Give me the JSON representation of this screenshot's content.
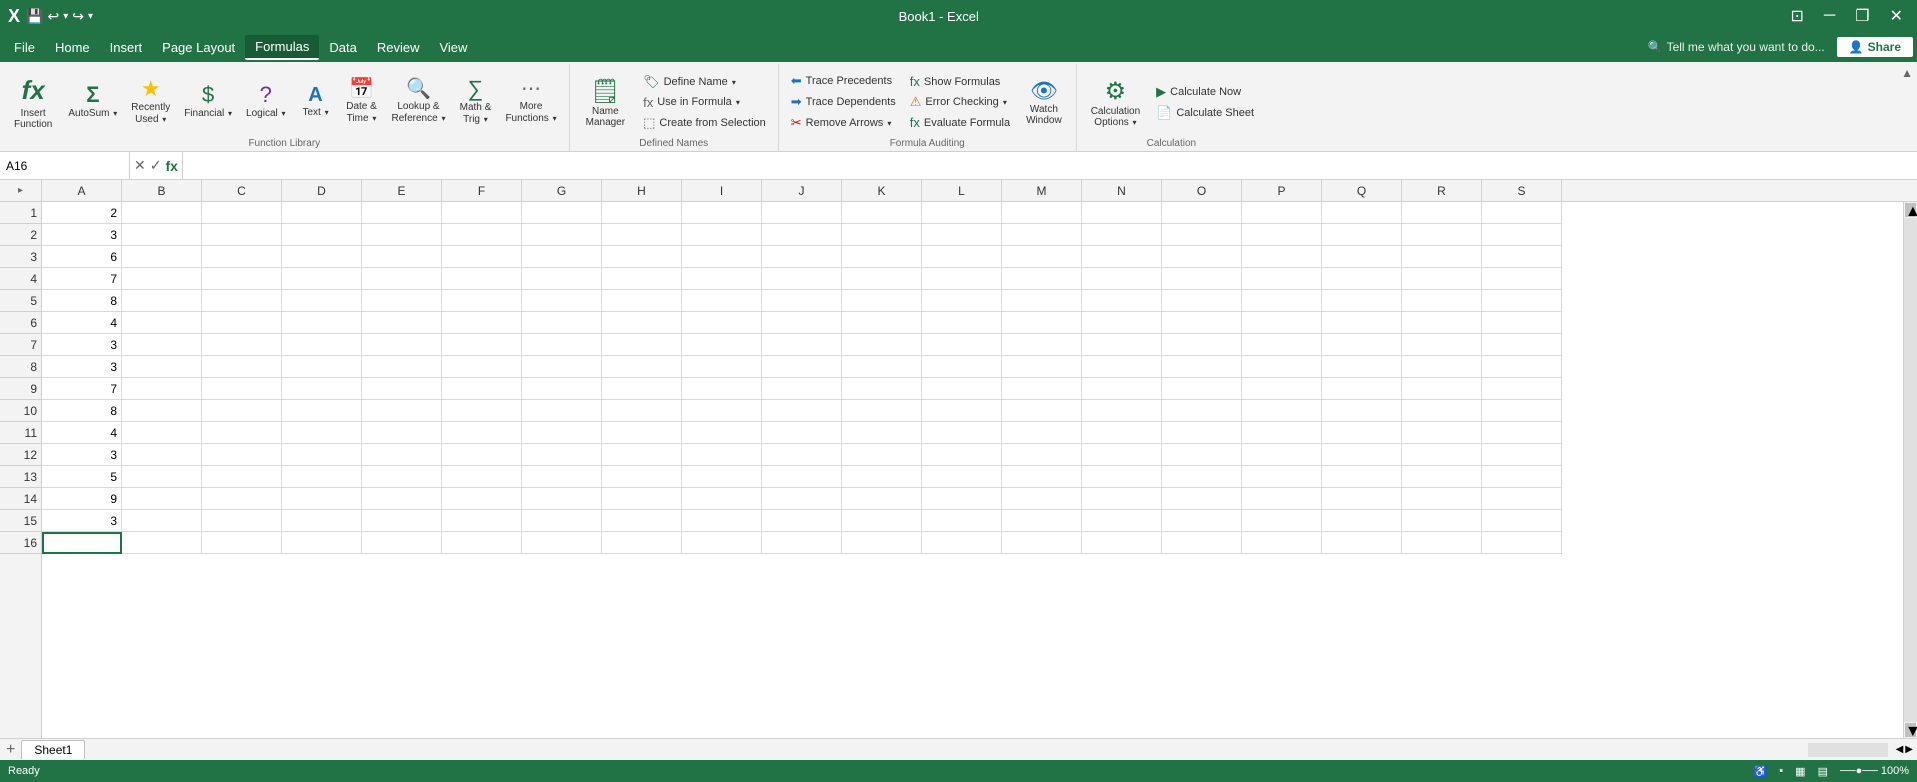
{
  "titlebar": {
    "title": "Book1 - Excel",
    "save_icon": "💾",
    "undo_icon": "↩",
    "redo_icon": "↪",
    "dropdown_icon": "▾",
    "minimize_icon": "─",
    "restore_icon": "❐",
    "close_icon": "✕",
    "window_icon": "⊞"
  },
  "menubar": {
    "items": [
      "File",
      "Home",
      "Insert",
      "Page Layout",
      "Formulas",
      "Data",
      "Review",
      "View"
    ],
    "active": "Formulas",
    "search_placeholder": "Tell me what you want to do...",
    "share_label": "Share"
  },
  "ribbon": {
    "groups": [
      {
        "id": "function-library",
        "label": "Function Library",
        "items": [
          {
            "id": "insert-function",
            "icon": "fx",
            "label": "Insert\nFunction"
          },
          {
            "id": "autosum",
            "icon": "Σ",
            "label": "AutoSum",
            "dropdown": true
          },
          {
            "id": "recently-used",
            "icon": "★",
            "label": "Recently\nUsed",
            "dropdown": true
          },
          {
            "id": "financial",
            "icon": "₤",
            "label": "Financial",
            "dropdown": true
          },
          {
            "id": "logical",
            "icon": "?",
            "label": "Logical",
            "dropdown": true
          },
          {
            "id": "text",
            "icon": "A",
            "label": "Text",
            "dropdown": true
          },
          {
            "id": "date-time",
            "icon": "📅",
            "label": "Date &\nTime",
            "dropdown": true
          },
          {
            "id": "lookup-reference",
            "icon": "🔍",
            "label": "Lookup &\nReference",
            "dropdown": true
          },
          {
            "id": "math-trig",
            "icon": "∑",
            "label": "Math &\nTrig",
            "dropdown": true
          },
          {
            "id": "more-functions",
            "icon": "⋯",
            "label": "More\nFunctions",
            "dropdown": true
          }
        ]
      },
      {
        "id": "defined-names",
        "label": "Defined Names",
        "items": [
          {
            "id": "name-manager",
            "icon": "🗒",
            "label": "Name\nManager"
          },
          {
            "id": "define-name",
            "label": "Define Name",
            "dropdown": true
          },
          {
            "id": "use-in-formula",
            "label": "Use in Formula",
            "dropdown": true
          },
          {
            "id": "create-from-selection",
            "label": "Create from Selection"
          }
        ]
      },
      {
        "id": "formula-auditing",
        "label": "Formula Auditing",
        "items": [
          {
            "id": "trace-precedents",
            "label": "Trace Precedents"
          },
          {
            "id": "trace-dependents",
            "label": "Trace Dependents"
          },
          {
            "id": "remove-arrows",
            "label": "Remove Arrows",
            "dropdown": true
          },
          {
            "id": "show-formulas",
            "label": "Show Formulas"
          },
          {
            "id": "error-checking",
            "label": "Error Checking",
            "dropdown": true
          },
          {
            "id": "evaluate-formula",
            "label": "Evaluate Formula"
          },
          {
            "id": "watch-window",
            "icon": "👁",
            "label": "Watch\nWindow"
          }
        ]
      },
      {
        "id": "calculation",
        "label": "Calculation",
        "items": [
          {
            "id": "calculation-options",
            "icon": "⚙",
            "label": "Calculation\nOptions",
            "dropdown": true
          },
          {
            "id": "calculate-now",
            "label": "Calculate Now"
          },
          {
            "id": "calculate-sheet",
            "label": "Calculate Sheet"
          }
        ]
      }
    ]
  },
  "formula_bar": {
    "cell_ref": "A16",
    "cancel_icon": "✕",
    "confirm_icon": "✓",
    "fn_icon": "fx"
  },
  "spreadsheet": {
    "columns": [
      "A",
      "B",
      "C",
      "D",
      "E",
      "F",
      "G",
      "H",
      "I",
      "J",
      "K",
      "L",
      "M",
      "N",
      "O",
      "P",
      "Q",
      "R",
      "S"
    ],
    "rows": [
      1,
      2,
      3,
      4,
      5,
      6,
      7,
      8,
      9,
      10,
      11,
      12,
      13,
      14,
      15,
      16
    ],
    "cell_data": {
      "A1": "2",
      "A2": "3",
      "A3": "6",
      "A4": "7",
      "A5": "8",
      "A6": "4",
      "A7": "3",
      "A8": "3",
      "A9": "7",
      "A10": "8",
      "A11": "4",
      "A12": "3",
      "A13": "5",
      "A14": "9",
      "A15": "3",
      "A16": ""
    },
    "selected_cell": "A16",
    "sheet_tab": "Sheet1"
  },
  "status_bar": {
    "items": []
  }
}
